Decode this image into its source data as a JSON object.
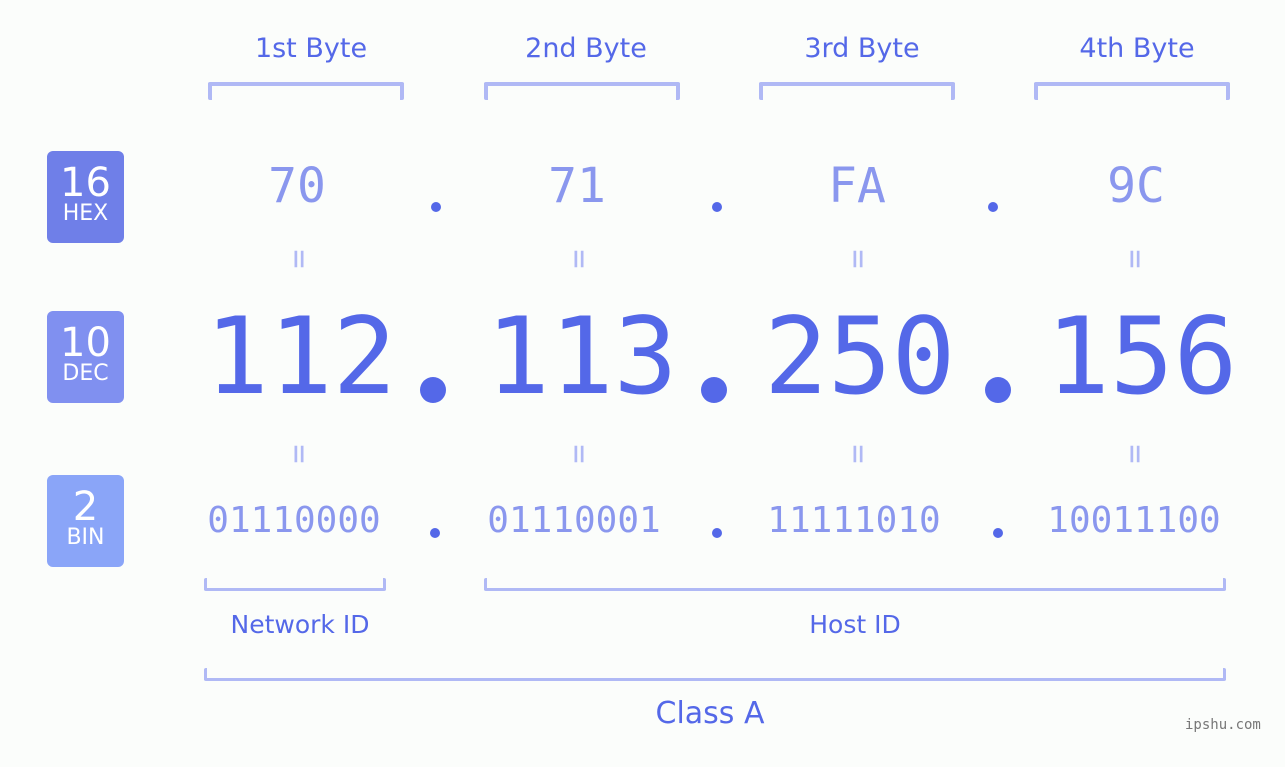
{
  "bytes": {
    "labels": [
      "1st Byte",
      "2nd Byte",
      "3rd Byte",
      "4th Byte"
    ]
  },
  "badges": {
    "hex": {
      "num": "16",
      "label": "HEX",
      "color": "#6f7fe8"
    },
    "dec": {
      "num": "10",
      "label": "DEC",
      "color": "#8090f0"
    },
    "bin": {
      "num": "2",
      "label": "BIN",
      "color": "#8aa5f8"
    }
  },
  "hex_values": [
    "70",
    "71",
    "FA",
    "9C"
  ],
  "dec_values": [
    "112",
    "113",
    "250",
    "156"
  ],
  "bin_values": [
    "01110000",
    "01110001",
    "11111010",
    "10011100"
  ],
  "equals_symbol": "=",
  "segments": {
    "network": "Network ID",
    "host": "Host ID",
    "class": "Class A"
  },
  "watermark": "ipshu.com",
  "colors": {
    "primary": "#5468e8",
    "secondary": "#8a97ee",
    "bracket": "#b0b9f5"
  }
}
